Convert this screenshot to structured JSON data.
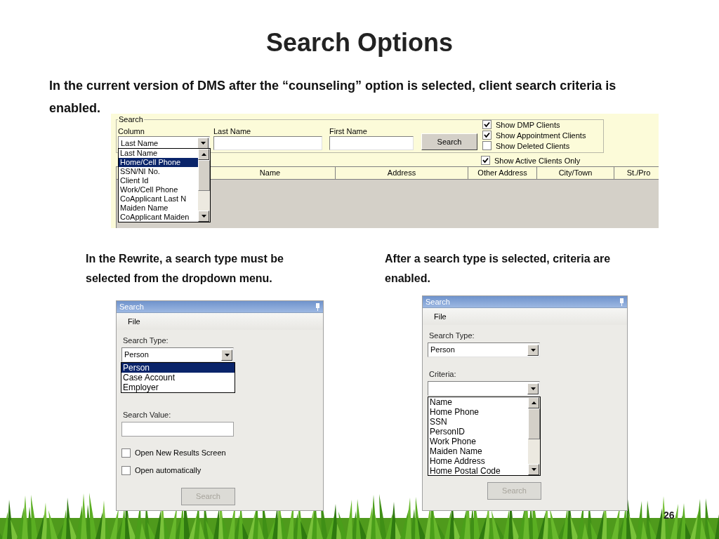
{
  "slide": {
    "title": "Search Options",
    "intro": "In the current version of DMS after the “counseling” option is selected, client search criteria is enabled.",
    "page_number": "26"
  },
  "legacy_screen": {
    "group_title": "Search",
    "column_label": "Column",
    "column_value": "Last Name",
    "last_name_label": "Last Name",
    "first_name_label": "First Name",
    "search_button": "Search",
    "checkboxes": [
      {
        "label": "Show DMP Clients",
        "checked": true
      },
      {
        "label": "Show Appointment Clients",
        "checked": true
      },
      {
        "label": "Show Deleted Clients",
        "checked": false
      }
    ],
    "active_only": {
      "label": "Show Active Clients Only",
      "checked": true
    },
    "dropdown_items": [
      {
        "label": "Last Name",
        "selected": false
      },
      {
        "label": "Home/Cell Phone",
        "selected": true
      },
      {
        "label": "SSN/NI No.",
        "selected": false
      },
      {
        "label": "Client Id",
        "selected": false
      },
      {
        "label": "Work/Cell Phone",
        "selected": false
      },
      {
        "label": "CoApplicant Last N",
        "selected": false
      },
      {
        "label": "Maiden Name",
        "selected": false
      },
      {
        "label": "CoApplicant Maiden",
        "selected": false
      }
    ],
    "grid_columns": [
      "Name",
      "Address",
      "Other Address",
      "City/Town",
      "St./Pro"
    ]
  },
  "rewrite_before": {
    "caption": "In the Rewrite, a search type must be selected from the dropdown menu.",
    "window_title": "Search",
    "menu": [
      "File"
    ],
    "search_type_label": "Search Type:",
    "search_type_value": "Person",
    "dropdown_items": [
      {
        "label": "Person",
        "selected": true
      },
      {
        "label": "Case Account",
        "selected": false
      },
      {
        "label": "Employer",
        "selected": false
      }
    ],
    "search_value_label": "Search Value:",
    "checkboxes": [
      {
        "label": "Open New Results Screen",
        "checked": false
      },
      {
        "label": "Open automatically",
        "checked": false
      }
    ],
    "search_button": {
      "label": "Search",
      "disabled": true
    }
  },
  "rewrite_after": {
    "caption": "After a search type is selected, criteria are enabled.",
    "window_title": "Search",
    "menu": [
      "File"
    ],
    "search_type_label": "Search Type:",
    "search_type_value": "Person",
    "criteria_label": "Criteria:",
    "criteria_items": [
      "Name",
      "Home Phone",
      "SSN",
      "PersonID",
      "Work Phone",
      "Maiden Name",
      "Home Address",
      "Home Postal Code"
    ],
    "search_button": {
      "label": "Search",
      "disabled": true
    }
  }
}
